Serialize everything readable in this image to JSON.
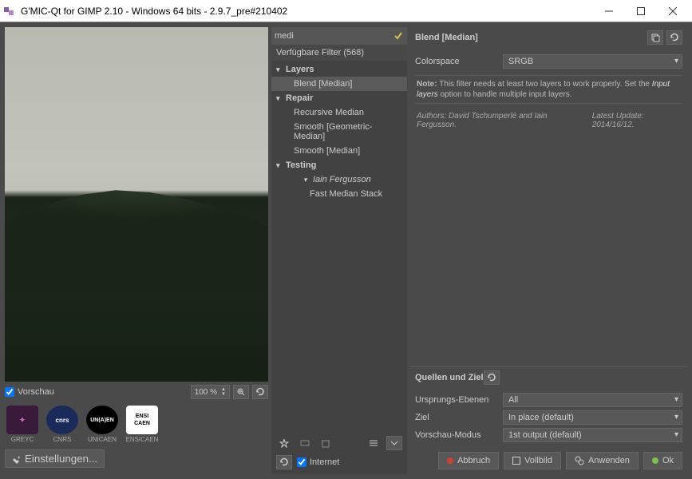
{
  "titlebar": {
    "title": "G'MIC-Qt for GIMP 2.10 - Windows 64 bits - 2.9.7_pre#210402"
  },
  "preview": {
    "checkbox": "Vorschau",
    "zoom": "100 %"
  },
  "logos": {
    "greyc": "GREYC",
    "cnrs": "CNRS",
    "unicaen": "UNICAEN",
    "ensicaen": "ENSICAEN"
  },
  "settings_btn": "Einstellungen...",
  "filters": {
    "search_value": "medi",
    "header": "Verfügbare Filter (568)",
    "tree": {
      "layers": "Layers",
      "blend_median": "Blend [Median]",
      "repair": "Repair",
      "recursive_median": "Recursive Median",
      "smooth_geo": "Smooth [Geometric-Median]",
      "smooth_median": "Smooth [Median]",
      "testing": "Testing",
      "iain": "Iain Fergusson",
      "fast_median": "Fast Median Stack"
    },
    "internet": "Internet"
  },
  "params": {
    "title": "Blend [Median]",
    "colorspace_lbl": "Colorspace",
    "colorspace_val": "SRGB",
    "note_bold": "Note:",
    "note_text": " This filter needs at least two layers to work properly. Set the ",
    "note_em": "Input layers",
    "note_end": " option to handle multiple input layers.",
    "authors_lbl": "Authors: ",
    "authors": "David Tschumperlé and Iain Fergusson.",
    "update_lbl": "Latest Update: ",
    "update": "2014/16/12."
  },
  "io": {
    "header": "Quellen und Ziel",
    "src_lbl": "Ursprungs-Ebenen",
    "src_val": "All",
    "tgt_lbl": "Ziel",
    "tgt_val": "In place (default)",
    "pvm_lbl": "Vorschau-Modus",
    "pvm_val": "1st output (default)"
  },
  "actions": {
    "cancel": "Abbruch",
    "full": "Vollbild",
    "apply": "Anwenden",
    "ok": "Ok"
  }
}
